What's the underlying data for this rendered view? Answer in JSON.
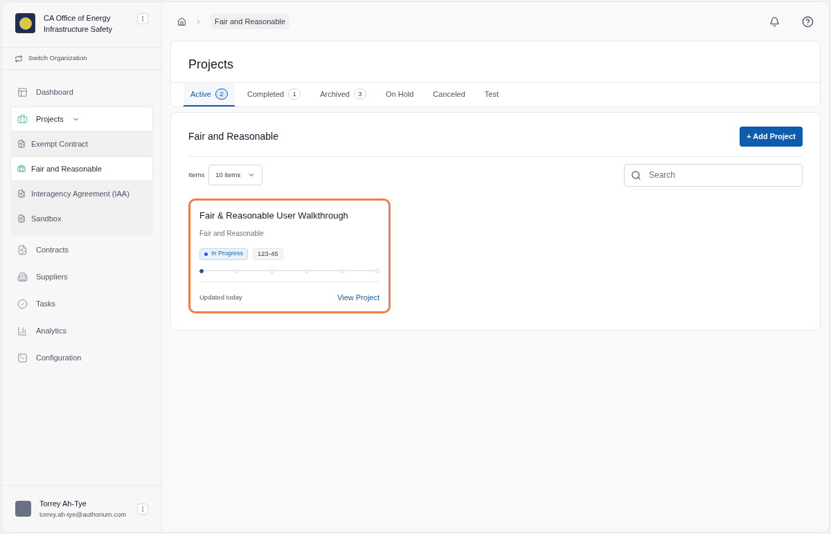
{
  "organization": {
    "name": "CA Office of Energy Infrastructure Safety",
    "switch_label": "Switch Organization"
  },
  "sidebar": {
    "items": [
      {
        "label": "Dashboard",
        "selected": false
      },
      {
        "label": "Projects",
        "selected": true,
        "expanded": true,
        "children": [
          {
            "label": "Exempt Contract",
            "selected": false
          },
          {
            "label": "Fair and Reasonable",
            "selected": true
          },
          {
            "label": "Interagency Agreement (IAA)",
            "selected": false
          },
          {
            "label": "Sandbox",
            "selected": false
          }
        ]
      },
      {
        "label": "Contracts",
        "selected": false
      },
      {
        "label": "Suppliers",
        "selected": false
      },
      {
        "label": "Tasks",
        "selected": false
      },
      {
        "label": "Analytics",
        "selected": false
      },
      {
        "label": "Configuration",
        "selected": false
      }
    ]
  },
  "user": {
    "name": "Torrey Ah-Tye",
    "email": "torrey.ah-tye@authorium.com"
  },
  "breadcrumb": [
    "Fair and Reasonable"
  ],
  "page_title": "Projects",
  "tabs": [
    {
      "label": "Active",
      "count": "2",
      "selected": true
    },
    {
      "label": "Completed",
      "count": "1",
      "selected": false
    },
    {
      "label": "Archived",
      "count": "3",
      "selected": false
    },
    {
      "label": "On Hold",
      "selected": false
    },
    {
      "label": "Canceled",
      "selected": false
    },
    {
      "label": "Test",
      "selected": false
    }
  ],
  "section": {
    "title": "Fair and Reasonable",
    "add_button": "+ Add Project",
    "items_label": "Items",
    "items_value": "10 items",
    "search_placeholder": "Search"
  },
  "projects": [
    {
      "title": "Fair & Reasonable User Walkthrough",
      "subtitle": "Fair and Reasonable",
      "highlighted": true,
      "status": "In Progress",
      "color": "#1d5bd6",
      "code": "123-45",
      "steps": [
        {
          "done": true
        },
        {
          "done": false
        },
        {
          "done": false
        },
        {
          "done": false
        },
        {
          "done": false
        },
        {
          "done": false
        }
      ],
      "updated": "Updated today",
      "link": "View Project"
    }
  ]
}
